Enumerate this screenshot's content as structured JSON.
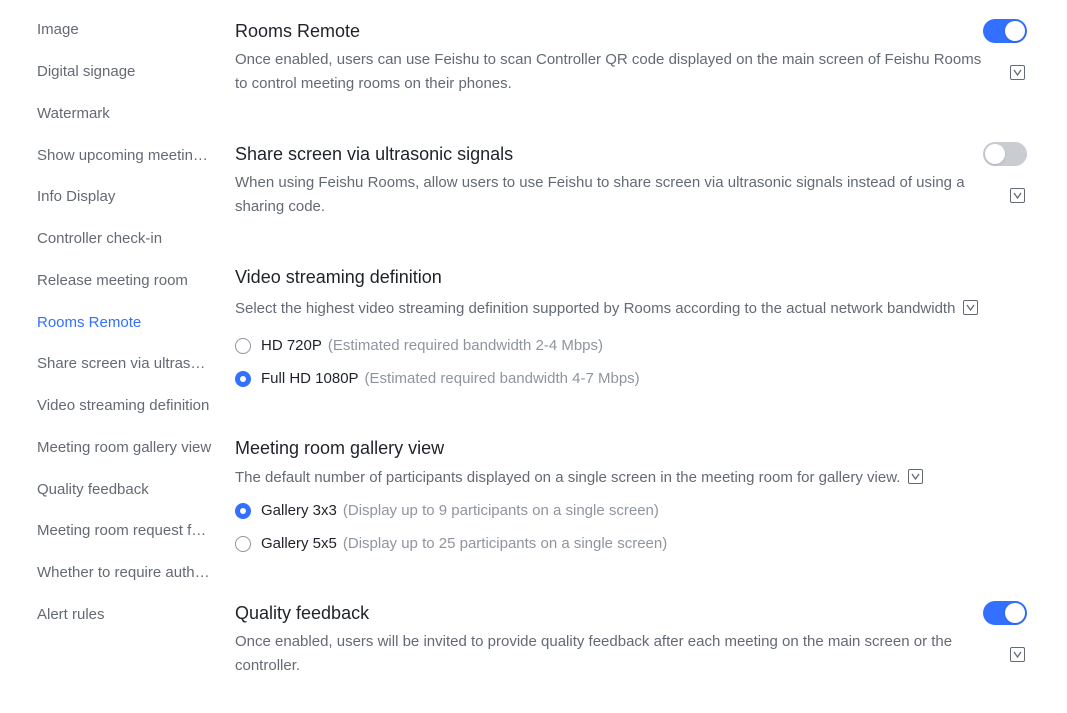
{
  "sidebar": {
    "items": [
      {
        "label": "Image"
      },
      {
        "label": "Digital signage"
      },
      {
        "label": "Watermark"
      },
      {
        "label": "Show upcoming meeting info"
      },
      {
        "label": "Info Display"
      },
      {
        "label": "Controller check-in"
      },
      {
        "label": "Release meeting room"
      },
      {
        "label": "Rooms Remote",
        "active": true
      },
      {
        "label": "Share screen via ultrasonic signals"
      },
      {
        "label": "Video streaming definition"
      },
      {
        "label": "Meeting room gallery view"
      },
      {
        "label": "Quality feedback"
      },
      {
        "label": "Meeting room request form"
      },
      {
        "label": "Whether to require authentication"
      },
      {
        "label": "Alert rules"
      }
    ]
  },
  "sections": {
    "rooms_remote": {
      "title": "Rooms Remote",
      "desc": "Once enabled, users can use Feishu to scan Controller QR code displayed on the main screen of Feishu Rooms to control meeting rooms on their phones.",
      "enabled": true
    },
    "ultrasonic": {
      "title": "Share screen via ultrasonic signals",
      "desc": "When using Feishu Rooms, allow users to use Feishu to share screen via ultrasonic signals instead of using a sharing code.",
      "enabled": false
    },
    "video": {
      "title": "Video streaming definition",
      "desc": "Select the highest video streaming definition supported by Rooms according to the actual network bandwidth",
      "options": [
        {
          "label": "HD 720P",
          "hint": "(Estimated required bandwidth 2-4 Mbps)",
          "checked": false
        },
        {
          "label": "Full HD 1080P",
          "hint": "(Estimated required bandwidth 4-7 Mbps)",
          "checked": true
        }
      ]
    },
    "gallery": {
      "title": "Meeting room gallery view",
      "desc": "The default number of participants displayed on a single screen in the meeting room for gallery view.",
      "options": [
        {
          "label": "Gallery 3x3",
          "hint": "(Display up to 9 participants on a single screen)",
          "checked": true
        },
        {
          "label": "Gallery 5x5",
          "hint": "(Display up to 25 participants on a single screen)",
          "checked": false
        }
      ]
    },
    "quality": {
      "title": "Quality feedback",
      "desc": "Once enabled, users will be invited to provide quality feedback after each meeting on the main screen or the controller.",
      "enabled": true
    }
  },
  "colors": {
    "accent": "#3370ff",
    "text_primary": "#1f2329",
    "text_secondary": "#646a73",
    "text_hint": "#8f959e",
    "toggle_off": "#c9ccd1"
  },
  "icons": {
    "edit": "edit-icon"
  }
}
